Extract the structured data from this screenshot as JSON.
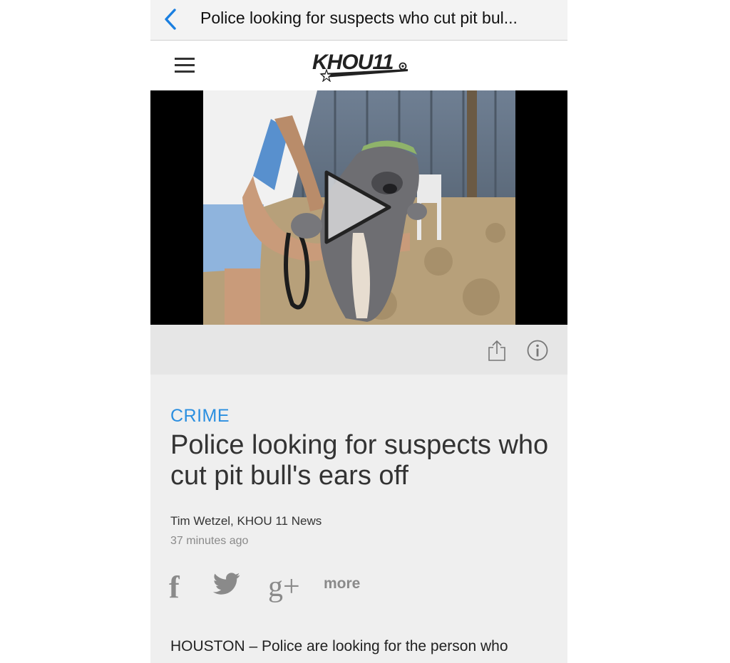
{
  "navbar": {
    "back_icon": "chevron-left-icon",
    "title": "Police looking for suspects who cut pit bul..."
  },
  "header": {
    "menu_icon": "hamburger-menu-icon",
    "logo": "KHOU11"
  },
  "video": {
    "play_icon": "play-icon"
  },
  "toolbar": {
    "share_icon": "share-icon",
    "info_icon": "info-icon"
  },
  "article": {
    "category": "CRIME",
    "headline": "Police looking for suspects who cut pit bull's ears off",
    "byline": "Tim Wetzel, KHOU 11 News",
    "timestamp": "37 minutes ago",
    "social": {
      "facebook": "f",
      "twitter_icon": "twitter-icon",
      "google_plus": "g+",
      "more": "more"
    },
    "body_start": "HOUSTON – Police are looking for the person who"
  },
  "colors": {
    "accent": "#2b8fe0",
    "background": "#efefef",
    "text": "#333333",
    "muted": "#8a8a8a"
  }
}
